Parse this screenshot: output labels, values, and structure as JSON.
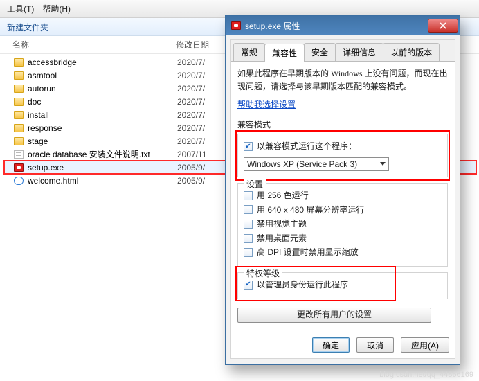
{
  "menubar": {
    "tools": "工具(T)",
    "help": "帮助(H)"
  },
  "toolbar": {
    "newFolder": "新建文件夹"
  },
  "columns": {
    "name": "名称",
    "date": "修改日期"
  },
  "files": [
    {
      "name": "accessbridge",
      "date": "2020/7/",
      "type": "folder"
    },
    {
      "name": "asmtool",
      "date": "2020/7/",
      "type": "folder"
    },
    {
      "name": "autorun",
      "date": "2020/7/",
      "type": "folder"
    },
    {
      "name": "doc",
      "date": "2020/7/",
      "type": "folder"
    },
    {
      "name": "install",
      "date": "2020/7/",
      "type": "folder"
    },
    {
      "name": "response",
      "date": "2020/7/",
      "type": "folder"
    },
    {
      "name": "stage",
      "date": "2020/7/",
      "type": "folder"
    },
    {
      "name": "oracle database 安装文件说明.txt",
      "date": "2007/11",
      "type": "txt"
    },
    {
      "name": "setup.exe",
      "date": "2005/9/",
      "type": "exe",
      "selected": true
    },
    {
      "name": "welcome.html",
      "date": "2005/9/",
      "type": "html"
    }
  ],
  "dialog": {
    "title": "setup.exe 属性",
    "tabs": {
      "general": "常规",
      "compat": "兼容性",
      "security": "安全",
      "details": "详细信息",
      "previous": "以前的版本"
    },
    "hint": "如果此程序在早期版本的 Windows 上没有问题，而现在出现问题，请选择与该早期版本匹配的兼容模式。",
    "helpLink": "帮助我选择设置",
    "compatMode": {
      "group": "兼容模式",
      "cbLabel": "以兼容模式运行这个程序：",
      "selected": "Windows XP (Service Pack 3)"
    },
    "settings": {
      "group": "设置",
      "opt256": "用 256 色运行",
      "opt640": "用 640 x 480 屏幕分辨率运行",
      "optTheme": "禁用视觉主题",
      "optDesktop": "禁用桌面元素",
      "optDpi": "高 DPI 设置时禁用显示缩放"
    },
    "privilege": {
      "group": "特权等级",
      "cbLabel": "以管理员身份运行此程序"
    },
    "allUsersBtn": "更改所有用户的设置",
    "buttons": {
      "ok": "确定",
      "cancel": "取消",
      "apply": "应用(A)"
    }
  },
  "watermark": "blog.csdn.net/qq_44866169"
}
